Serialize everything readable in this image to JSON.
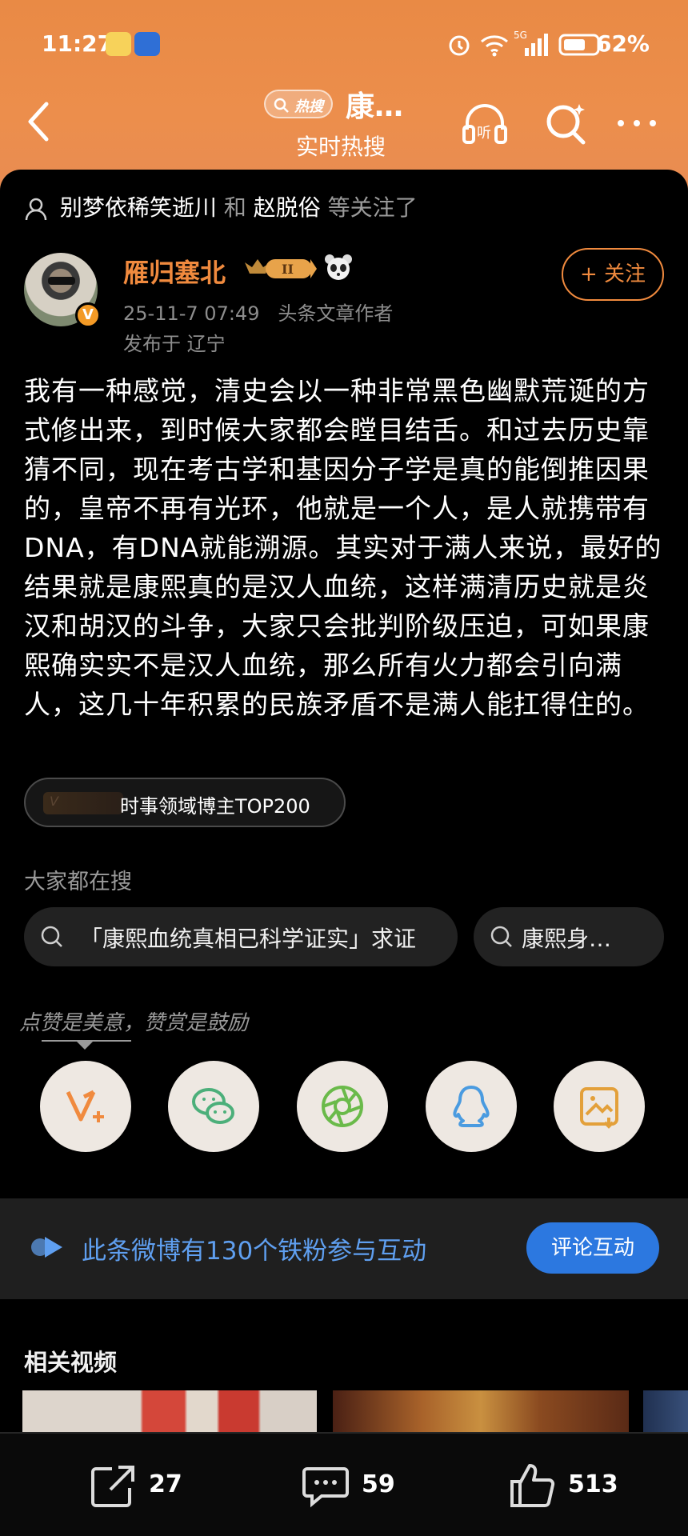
{
  "status_bar": {
    "time": "11:27",
    "battery": "62%"
  },
  "nav": {
    "hot_tag": "热搜",
    "title": "康…",
    "subtitle": "实时热搜"
  },
  "follow_note": {
    "user1": "别梦依稀笑逝川",
    "and": "和",
    "user2": "赵脱俗",
    "suffix": "等关注了"
  },
  "post": {
    "author": "雁归塞北",
    "date": "25-11-7 07:49",
    "role": "头条文章作者",
    "location": "发布于 辽宁",
    "follow_label": "+ 关注",
    "text": "我有一种感觉，清史会以一种非常黑色幽默荒诞的方式修出来，到时候大家都会瞠目结舌。和过去历史靠猜不同，现在考古学和基因分子学是真的能倒推因果的，皇帝不再有光环，他就是一个人，是人就携带有DNA，有DNA就能溯源。其实对于满人来说，最好的结果就是康熙真的是汉人血统，这样满清历史就是炎汉和胡汉的斗争，大家只会批判阶级压迫，可如果康熙确实实不是汉人血统，那么所有火力都会引向满人，这几十年积累的民族矛盾不是满人能扛得住的。",
    "rank_label": "时事领域博主TOP200"
  },
  "search": {
    "heading": "大家都在搜",
    "chips": [
      "「康熙血统真相已科学证实」求证",
      "康熙身…"
    ]
  },
  "share": {
    "hint": "点赞是美意，赞赏是鼓励",
    "icons": [
      "v-plus-icon",
      "wechat-icon",
      "moments-icon",
      "qq-icon",
      "save-image-icon"
    ]
  },
  "fans": {
    "text": "此条微博有130个铁粉参与互动",
    "button": "评论互动"
  },
  "related": {
    "heading": "相关视频"
  },
  "actions": {
    "repost": "27",
    "comment": "59",
    "like": "513"
  },
  "colors": {
    "accent_orange": "#f08a3e",
    "link_blue": "#5f9ff0",
    "button_blue": "#2c78e0",
    "header": "#ec8e4c"
  }
}
